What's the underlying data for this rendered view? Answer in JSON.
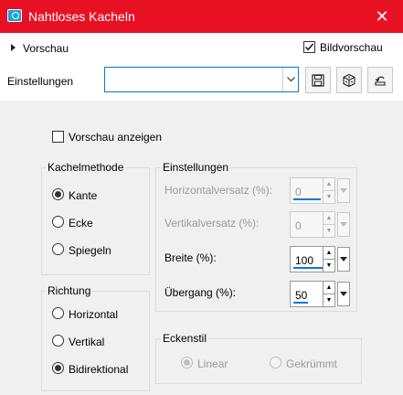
{
  "window": {
    "title": "Nahtloses Kacheln",
    "close_glyph": "✕"
  },
  "toolbar": {
    "preview_toggle_label": "Vorschau",
    "bildvorschau_label": "Bildvorschau",
    "bildvorschau_checked": true,
    "settings_label": "Einstellungen",
    "settings_value": "",
    "buttons": [
      "save-icon",
      "random-cube-icon",
      "reset-icon"
    ]
  },
  "preview_option": {
    "label": "Vorschau anzeigen",
    "checked": false
  },
  "kachelmethode": {
    "title": "Kachelmethode",
    "options": [
      "Kante",
      "Ecke",
      "Spiegeln"
    ],
    "selected": "Kante"
  },
  "richtung": {
    "title": "Richtung",
    "options": [
      "Horizontal",
      "Vertikal",
      "Bidirektional"
    ],
    "selected": "Bidirektional"
  },
  "einstellungen": {
    "title": "Einstellungen",
    "horizontalversatz": {
      "label": "Horizontalversatz (%):",
      "value": "0",
      "enabled": false
    },
    "vertikalversatz": {
      "label": "Vertikalversatz (%):",
      "value": "0",
      "enabled": false
    },
    "breite": {
      "label": "Breite (%):",
      "value": "100",
      "enabled": true
    },
    "uebergang": {
      "label": "Übergang (%):",
      "value": "50",
      "enabled": true
    }
  },
  "eckenstil": {
    "title": "Eckenstil",
    "options": [
      "Linear",
      "Gekrümmt"
    ],
    "selected": "Linear",
    "enabled": false
  },
  "colors": {
    "titlebar": "#e81123",
    "accent": "#0078d7",
    "panel": "#f0f0f0"
  }
}
